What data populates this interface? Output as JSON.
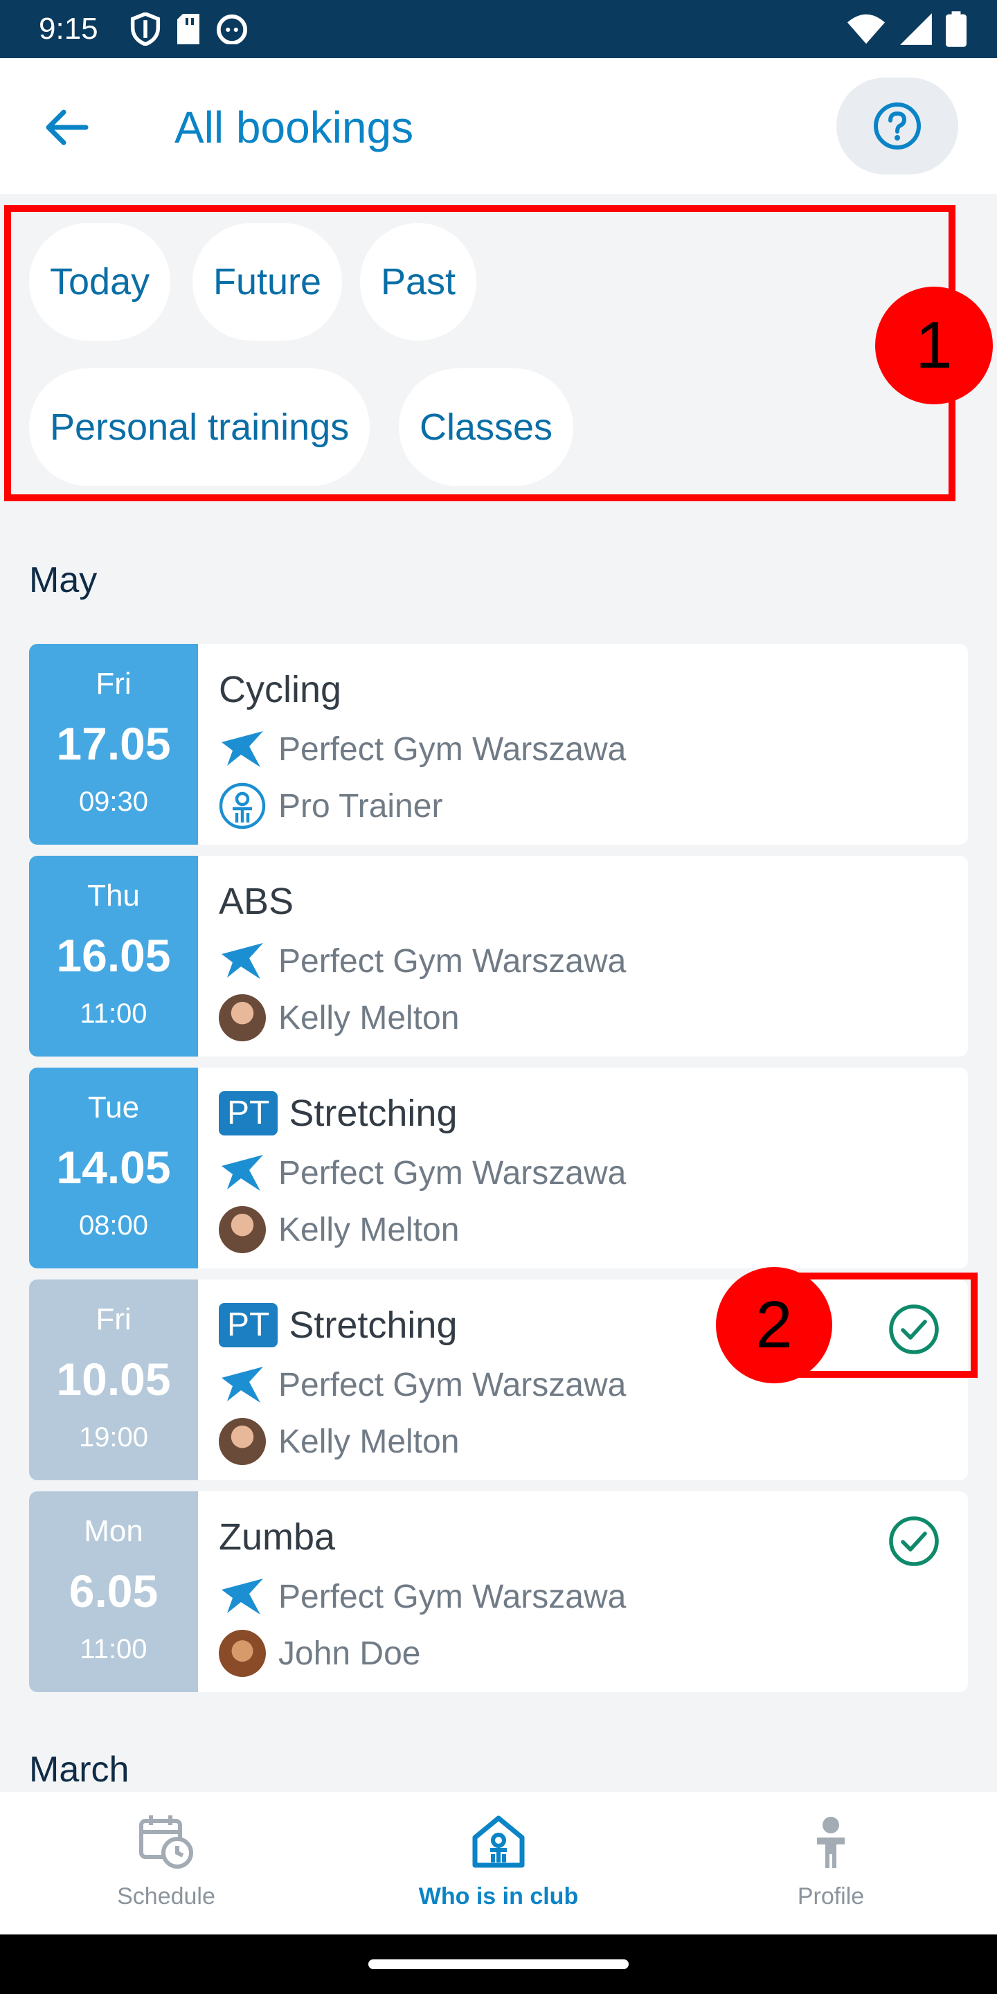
{
  "status_bar": {
    "time": "9:15"
  },
  "app_bar": {
    "title": "All bookings"
  },
  "filters": [
    {
      "label": "Today"
    },
    {
      "label": "Future"
    },
    {
      "label": "Past"
    },
    {
      "label": "Personal trainings"
    },
    {
      "label": "Classes"
    }
  ],
  "annotations": [
    "1",
    "2"
  ],
  "sections": [
    {
      "month": "May",
      "bookings": [
        {
          "dow": "Fri",
          "date": "17.05",
          "time": "09:30",
          "title": "Cycling",
          "pt": false,
          "club": "Perfect Gym Warszawa",
          "trainer": "Pro Trainer",
          "trainer_icon": "trainer-icon",
          "state": "active",
          "checked": false
        },
        {
          "dow": "Thu",
          "date": "16.05",
          "time": "11:00",
          "title": "ABS",
          "pt": false,
          "club": "Perfect Gym Warszawa",
          "trainer": "Kelly Melton",
          "trainer_icon": "avatar",
          "state": "active",
          "checked": false
        },
        {
          "dow": "Tue",
          "date": "14.05",
          "time": "08:00",
          "title": "Stretching",
          "pt": true,
          "pt_label": "PT",
          "club": "Perfect Gym Warszawa",
          "trainer": "Kelly Melton",
          "trainer_icon": "avatar",
          "state": "active",
          "checked": false
        },
        {
          "dow": "Fri",
          "date": "10.05",
          "time": "19:00",
          "title": "Stretching",
          "pt": true,
          "pt_label": "PT",
          "club": "Perfect Gym Warszawa",
          "trainer": "Kelly Melton",
          "trainer_icon": "avatar",
          "state": "past",
          "checked": true
        },
        {
          "dow": "Mon",
          "date": "6.05",
          "time": "11:00",
          "title": "Zumba",
          "pt": false,
          "club": "Perfect Gym Warszawa",
          "trainer": "John Doe",
          "trainer_icon": "avatar",
          "state": "past",
          "checked": true
        }
      ]
    },
    {
      "month": "March",
      "bookings": []
    }
  ],
  "bottom_nav": [
    {
      "label": "Schedule",
      "icon": "schedule-icon",
      "active": false
    },
    {
      "label": "Who is in club",
      "icon": "club-icon",
      "active": true
    },
    {
      "label": "Profile",
      "icon": "profile-icon",
      "active": false
    }
  ],
  "colors": {
    "accent": "#0a84c6",
    "date_active": "#45a8e3",
    "date_past": "#b5c9da",
    "check": "#0e8a6a",
    "annotation": "#ff0000"
  }
}
